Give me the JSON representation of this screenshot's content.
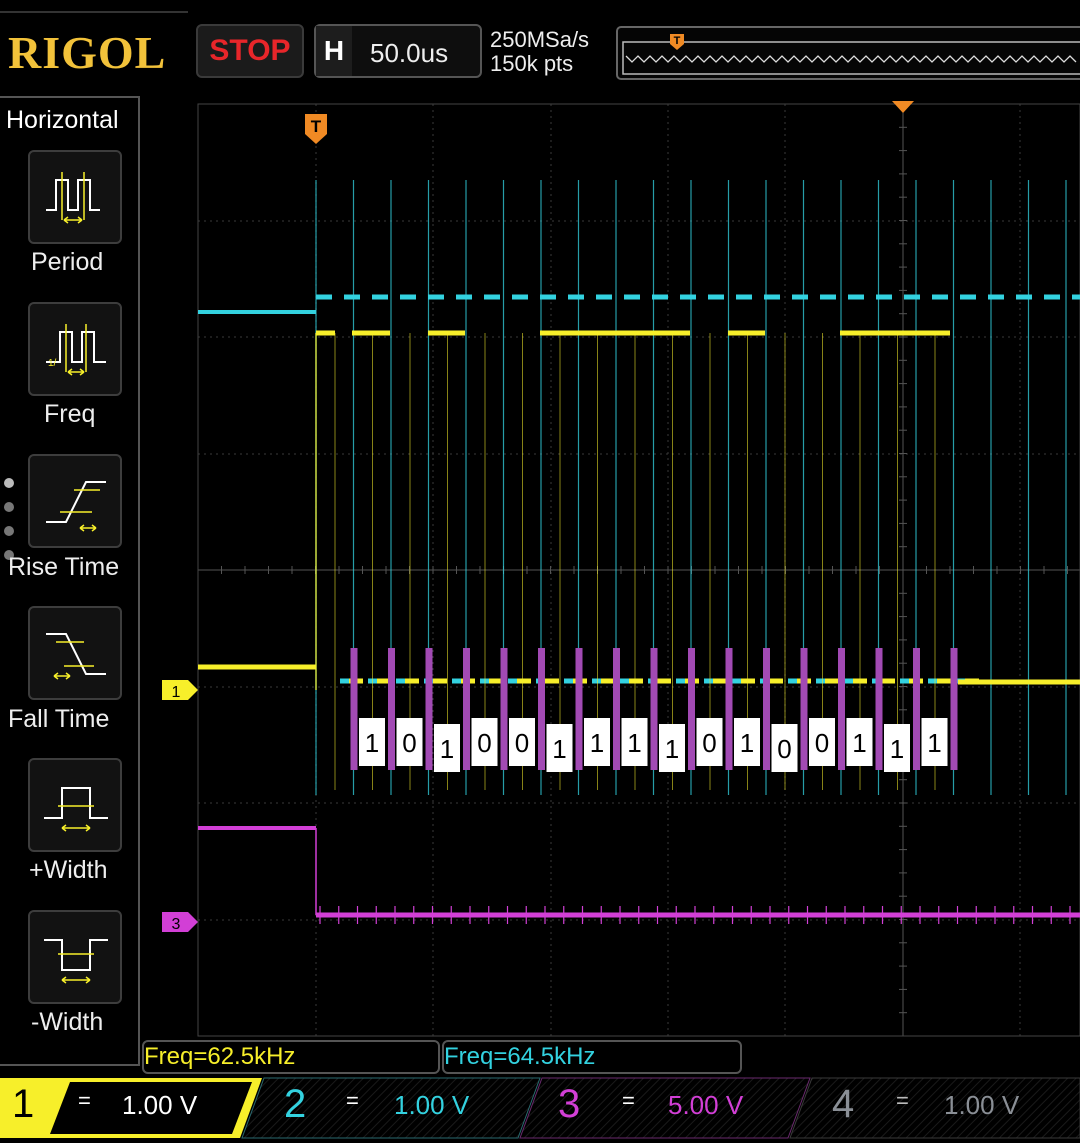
{
  "brand": "RIGOL",
  "run_state": "STOP",
  "timebase": {
    "label": "H",
    "value": "50.0us"
  },
  "acquisition": {
    "sample_rate": "250MSa/s",
    "memory_depth": "150k pts"
  },
  "trigger_marker": "T",
  "menu": {
    "title": "Horizontal",
    "items": [
      {
        "label": "Period"
      },
      {
        "label": "Freq"
      },
      {
        "label": "Rise Time"
      },
      {
        "label": "Fall Time"
      },
      {
        "label": "+Width"
      },
      {
        "label": "-Width"
      }
    ]
  },
  "channel_markers": {
    "ch1": "1",
    "ch3": "3"
  },
  "decoded_bits": [
    "1",
    "0",
    "1",
    "0",
    "0",
    "1",
    "1",
    "1",
    "1",
    "0",
    "1",
    "0",
    "0",
    "1",
    "1",
    "1"
  ],
  "measurements": [
    {
      "text": "Freq=62.5kHz",
      "color": "#f7ef2a"
    },
    {
      "text": "Freq=64.5kHz",
      "color": "#33d2e0"
    }
  ],
  "channels": [
    {
      "number": "1",
      "coupling": "=",
      "scale": "1.00 V",
      "color": "#f7ef2a",
      "active": true
    },
    {
      "number": "2",
      "coupling": "=",
      "scale": "1.00 V",
      "color": "#33d2e0",
      "active": true
    },
    {
      "number": "3",
      "coupling": "=",
      "scale": "5.00 V",
      "color": "#d23fd6",
      "active": true
    },
    {
      "number": "4",
      "coupling": "=",
      "scale": "1.00 V",
      "color": "#8a8f96",
      "active": false
    }
  ]
}
